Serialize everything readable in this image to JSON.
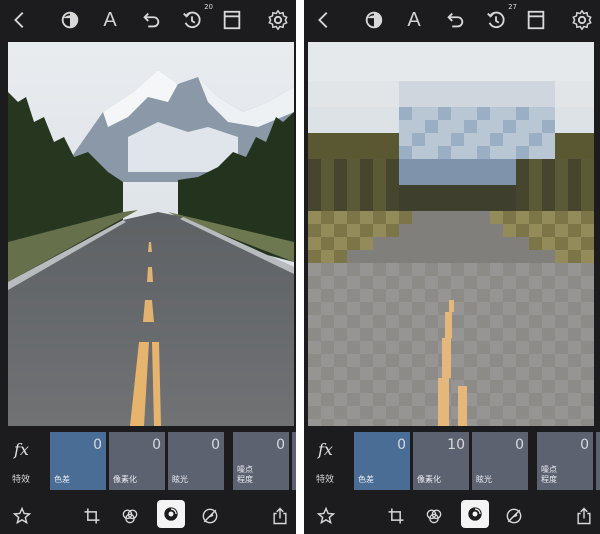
{
  "colors": {
    "panel_bg": "#1c1c1e",
    "icon": "#d8d8d8",
    "tile_bg": "#5d6270",
    "tile_active": "#4a6d96"
  },
  "panels": [
    {
      "toolbar": {
        "history_count": "20",
        "text_tool": "A",
        "icons": [
          "chevron-left-icon",
          "mask-icon",
          "text-icon",
          "undo-icon",
          "history-icon",
          "layers-icon",
          "gear-icon"
        ]
      },
      "photo": {
        "style": "original"
      },
      "effects_label": "特效",
      "fx_symbol": "fx",
      "filters": [
        {
          "label": "色差",
          "value": "0",
          "active": true
        },
        {
          "label": "像素化",
          "value": "0",
          "active": false
        },
        {
          "label": "眩光",
          "value": "0",
          "active": false
        },
        {
          "label": "噪点\n程度",
          "value": "0",
          "active": false
        },
        {
          "label": "",
          "value": "",
          "active": false
        }
      ],
      "bottom_icons": [
        "star-icon",
        "crop-icon",
        "adjust-icon",
        "effects-icon",
        "retouch-icon",
        "share-icon"
      ]
    },
    {
      "toolbar": {
        "history_count": "27",
        "text_tool": "A",
        "icons": [
          "chevron-left-icon",
          "mask-icon",
          "text-icon",
          "undo-icon",
          "history-icon",
          "layers-icon",
          "gear-icon"
        ]
      },
      "photo": {
        "style": "pixelated"
      },
      "effects_label": "特效",
      "fx_symbol": "fx",
      "filters": [
        {
          "label": "色差",
          "value": "0",
          "active": true
        },
        {
          "label": "像素化",
          "value": "10",
          "active": false
        },
        {
          "label": "眩光",
          "value": "0",
          "active": false
        },
        {
          "label": "噪点\n程度",
          "value": "0",
          "active": false
        },
        {
          "label": "",
          "value": "",
          "active": false
        }
      ],
      "bottom_icons": [
        "star-icon",
        "crop-icon",
        "adjust-icon",
        "effects-icon",
        "retouch-icon",
        "share-icon"
      ]
    }
  ]
}
